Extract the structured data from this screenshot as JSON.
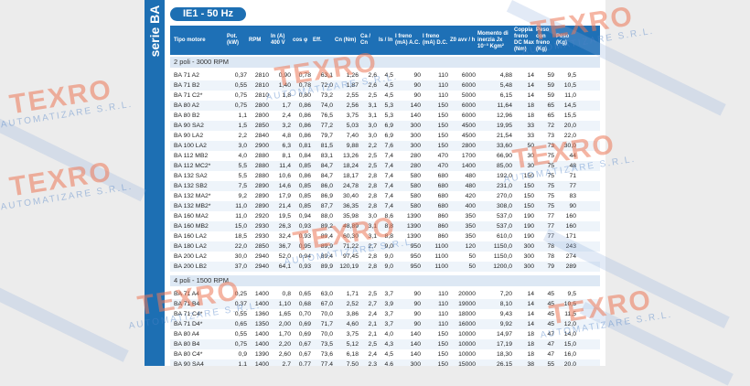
{
  "sidebar": {
    "title": "serie BA"
  },
  "badge": "IE1 - 50 Hz",
  "columns": [
    "Tipo motore",
    "Pot. (kW)",
    "RPM",
    "In (A) 400 V",
    "cos φ",
    "Eff.",
    "Cn (Nm)",
    "Ca / Cn",
    "Is / In",
    "I freno (mA) A.C.",
    "I freno (mA) D.C.",
    "Z0 avv / h",
    "Momento di inerzia Jx 10⁻³ Kgm²",
    "Coppia freno DC Max (Nm)",
    "Peso con freno (Kg)",
    "Peso (Kg)"
  ],
  "sections": [
    {
      "title": "2 poli - 3000 RPM",
      "rows": [
        [
          "BA 71 A2",
          "0,37",
          "2810",
          "0,90",
          "0,78",
          "63,1",
          "1,26",
          "2,6",
          "4,5",
          "90",
          "110",
          "6000",
          "4,88",
          "14",
          "59",
          "9,5"
        ],
        [
          "BA 71 B2",
          "0,55",
          "2810",
          "1,40",
          "0,78",
          "72,0",
          "1,87",
          "2,6",
          "4,5",
          "90",
          "110",
          "6000",
          "5,48",
          "14",
          "59",
          "10,5"
        ],
        [
          "BA 71 C2*",
          "0,75",
          "2810",
          "1,8",
          "0,80",
          "73,2",
          "2,55",
          "2,5",
          "4,5",
          "90",
          "110",
          "5000",
          "6,15",
          "14",
          "59",
          "11,0"
        ],
        [
          "BA 80 A2",
          "0,75",
          "2800",
          "1,7",
          "0,86",
          "74,0",
          "2,56",
          "3,1",
          "5,3",
          "140",
          "150",
          "6000",
          "11,64",
          "18",
          "65",
          "14,5"
        ],
        [
          "BA 80 B2",
          "1,1",
          "2800",
          "2,4",
          "0,86",
          "76,5",
          "3,75",
          "3,1",
          "5,3",
          "140",
          "150",
          "6000",
          "12,96",
          "18",
          "65",
          "15,5"
        ],
        [
          "BA 90 SA2",
          "1,5",
          "2850",
          "3,2",
          "0,86",
          "77,2",
          "5,03",
          "3,0",
          "6,9",
          "300",
          "150",
          "4500",
          "19,95",
          "33",
          "72",
          "20,0"
        ],
        [
          "BA 90 LA2",
          "2,2",
          "2840",
          "4,8",
          "0,86",
          "79,7",
          "7,40",
          "3,0",
          "6,9",
          "300",
          "150",
          "4500",
          "21,54",
          "33",
          "73",
          "22,0"
        ],
        [
          "BA 100 LA2",
          "3,0",
          "2900",
          "6,3",
          "0,81",
          "81,5",
          "9,88",
          "2,2",
          "7,6",
          "300",
          "150",
          "2800",
          "33,60",
          "50",
          "73",
          "30,0"
        ],
        [
          "BA 112 MB2",
          "4,0",
          "2880",
          "8,1",
          "0,84",
          "83,1",
          "13,26",
          "2,5",
          "7,4",
          "280",
          "470",
          "1700",
          "66,90",
          "30",
          "75",
          "44"
        ],
        [
          "BA 112 MC2*",
          "5,5",
          "2880",
          "11,4",
          "0,85",
          "84,7",
          "18,24",
          "2,5",
          "7,4",
          "280",
          "470",
          "1400",
          "85,00",
          "30",
          "75",
          "48"
        ],
        [
          "BA 132 SA2",
          "5,5",
          "2880",
          "10,6",
          "0,86",
          "84,7",
          "18,17",
          "2,8",
          "7,4",
          "580",
          "680",
          "480",
          "192,0",
          "150",
          "75",
          "71"
        ],
        [
          "BA 132 SB2",
          "7,5",
          "2890",
          "14,6",
          "0,85",
          "86,0",
          "24,78",
          "2,8",
          "7,4",
          "580",
          "680",
          "480",
          "231,0",
          "150",
          "75",
          "77"
        ],
        [
          "BA 132 MA2*",
          "9,2",
          "2890",
          "17,9",
          "0,85",
          "86,9",
          "30,40",
          "2,8",
          "7,4",
          "580",
          "680",
          "420",
          "270,0",
          "150",
          "75",
          "83"
        ],
        [
          "BA 132 MB2*",
          "11,0",
          "2890",
          "21,4",
          "0,85",
          "87,7",
          "36,35",
          "2,8",
          "7,4",
          "580",
          "680",
          "400",
          "308,0",
          "150",
          "75",
          "90"
        ],
        [
          "BA 160 MA2",
          "11,0",
          "2920",
          "19,5",
          "0,94",
          "88,0",
          "35,98",
          "3,0",
          "8,6",
          "1390",
          "860",
          "350",
          "537,0",
          "190",
          "77",
          "160"
        ],
        [
          "BA 160 MB2",
          "15,0",
          "2930",
          "26,3",
          "0,93",
          "89,2",
          "48,89",
          "3,1",
          "8,8",
          "1390",
          "860",
          "350",
          "537,0",
          "190",
          "77",
          "160"
        ],
        [
          "BA 160 LA2",
          "18,5",
          "2930",
          "32,4",
          "0,93",
          "89,4",
          "60,30",
          "3,1",
          "8,8",
          "1390",
          "860",
          "350",
          "610,0",
          "190",
          "77",
          "171"
        ],
        [
          "BA 180 LA2",
          "22,0",
          "2850",
          "36,7",
          "0,95",
          "89,9",
          "71,22",
          "2,7",
          "9,0",
          "950",
          "1100",
          "120",
          "1150,0",
          "300",
          "78",
          "243"
        ],
        [
          "BA 200 LA2",
          "30,0",
          "2940",
          "52,0",
          "0,94",
          "89,4",
          "97,45",
          "2,8",
          "9,0",
          "950",
          "1100",
          "50",
          "1150,0",
          "300",
          "78",
          "274"
        ],
        [
          "BA 200 LB2",
          "37,0",
          "2940",
          "64,1",
          "0,93",
          "89,9",
          "120,19",
          "2,8",
          "9,0",
          "950",
          "1100",
          "50",
          "1200,0",
          "300",
          "79",
          "289"
        ]
      ]
    },
    {
      "title": "4 poli - 1500 RPM",
      "rows": [
        [
          "BA 71 A4",
          "0,25",
          "1400",
          "0,8",
          "0,65",
          "63,0",
          "1,71",
          "2,5",
          "3,7",
          "90",
          "110",
          "20000",
          "7,20",
          "14",
          "45",
          "9,5"
        ],
        [
          "BA 71 B4",
          "0,37",
          "1400",
          "1,10",
          "0,68",
          "67,0",
          "2,52",
          "2,7",
          "3,9",
          "90",
          "110",
          "19000",
          "8,10",
          "14",
          "45",
          "10,5"
        ],
        [
          "BA 71 C4*",
          "0,55",
          "1360",
          "1,65",
          "0,70",
          "70,0",
          "3,86",
          "2,4",
          "3,7",
          "90",
          "110",
          "18000",
          "9,43",
          "14",
          "45",
          "11,5"
        ],
        [
          "BA 71 D4*",
          "0,65",
          "1350",
          "2,00",
          "0,69",
          "71,7",
          "4,60",
          "2,1",
          "3,7",
          "90",
          "110",
          "16000",
          "9,92",
          "14",
          "45",
          "12,0"
        ],
        [
          "BA 80 A4",
          "0,55",
          "1400",
          "1,70",
          "0,69",
          "70,0",
          "3,75",
          "2,1",
          "4,0",
          "140",
          "150",
          "10000",
          "14,97",
          "18",
          "47",
          "14,0"
        ],
        [
          "BA 80 B4",
          "0,75",
          "1400",
          "2,20",
          "0,67",
          "73,5",
          "5,12",
          "2,5",
          "4,3",
          "140",
          "150",
          "10000",
          "17,19",
          "18",
          "47",
          "15,0"
        ],
        [
          "BA 80 C4*",
          "0,9",
          "1390",
          "2,60",
          "0,67",
          "73,6",
          "6,18",
          "2,4",
          "4,5",
          "140",
          "150",
          "10000",
          "18,30",
          "18",
          "47",
          "16,0"
        ],
        [
          "BA 90 SA4",
          "1,1",
          "1400",
          "2,7",
          "0,77",
          "77,4",
          "7,50",
          "2,3",
          "4,6",
          "300",
          "150",
          "15000",
          "26,15",
          "38",
          "55",
          "20,0"
        ]
      ]
    }
  ],
  "watermark": {
    "title": "TEXRO",
    "subtitle": "AUTOMATIZARE S.R.L."
  }
}
